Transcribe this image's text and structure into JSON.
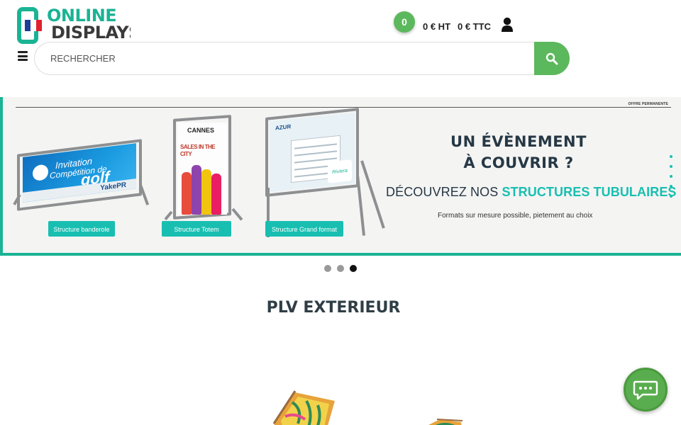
{
  "header": {
    "logo_line1": "ONLINE",
    "logo_line2": "DISPLAYS",
    "cart_count": "0",
    "price_ht": "0 € HT",
    "price_ttc": "0 € TTC",
    "user_icon": "user-icon",
    "menu_icon": "hamburger-menu-icon"
  },
  "search": {
    "placeholder": "RECHERCHER",
    "button_icon": "search-icon"
  },
  "banner": {
    "offer_label": "OFFRE PERMANENTE",
    "headline_line1": "UN ÉVÈNEMENT",
    "headline_line2": "À COUVRIR ?",
    "discover_prefix": "DÉCOUVREZ NOS",
    "discover_highlight": "STRUCTURES TUBULAIRES",
    "discover_suffix": " !",
    "subline": "Formats sur mesure possible, pietement au choix",
    "products": [
      {
        "label": "Structure banderole"
      },
      {
        "label": "Structure Totem"
      },
      {
        "label": "Structure Grand format"
      }
    ],
    "poster1": {
      "line1": "Invitation",
      "line2": "Compétition de",
      "line3": "golf",
      "brand": "YakePR"
    },
    "poster2": {
      "line1": "CANNES",
      "line2": "SALES IN THE CITY"
    },
    "poster3": {
      "brand": "AZUR",
      "sub": "Riviera"
    },
    "accent_color": "#18bfb1"
  },
  "carousel": {
    "slides": 3,
    "active_index": 2
  },
  "section": {
    "title": "PLV EXTERIEUR"
  },
  "chat": {
    "icon": "chat-bubble-icon",
    "color": "#5aad4e"
  },
  "colors": {
    "brand_teal": "#1ab394",
    "cart_green": "#5cb85c",
    "heading": "#263845"
  }
}
